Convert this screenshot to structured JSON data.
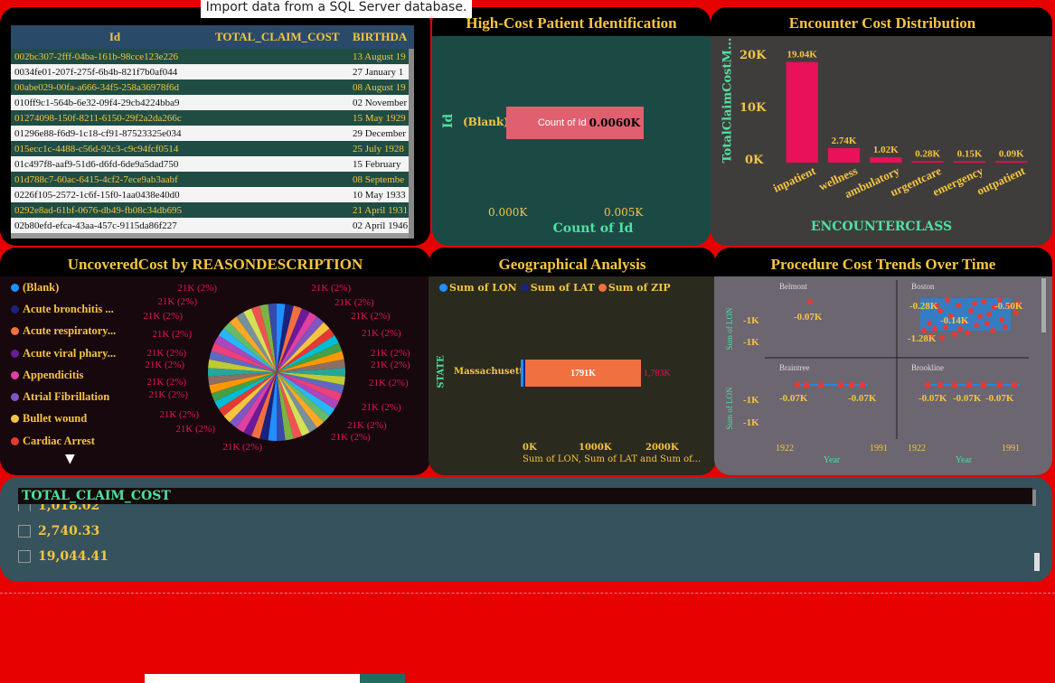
{
  "tooltip": "Import data from a SQL Server database.",
  "table": {
    "headers": [
      "Id",
      "TOTAL_CLAIM_COST",
      "BIRTHDA"
    ],
    "rows": [
      [
        "002bc307-2fff-04ba-161b-98cce123e226",
        "",
        "13 August 19"
      ],
      [
        "0034fe01-207f-275f-6b4b-821f7b0af044",
        "",
        "27 January 1"
      ],
      [
        "00abe029-00fa-a666-34f5-258a36978f6d",
        "",
        "08 August 19"
      ],
      [
        "010ff9c1-564b-6e32-09f4-29cb4224bba9",
        "",
        "02 November"
      ],
      [
        "01274098-150f-8211-6150-29f2a2da266c",
        "",
        "15 May 1929"
      ],
      [
        "01296e88-f6d9-1c18-cf91-87523325e034",
        "",
        "29 December"
      ],
      [
        "015ecc1c-4488-c56d-92c3-c9c94fcf0514",
        "",
        "25 July 1928"
      ],
      [
        "01c497f8-aaf9-51d6-d6fd-6de9a5dad750",
        "",
        "15 February"
      ],
      [
        "01d788c7-60ac-6415-4cf2-7ece9ab3aabf",
        "",
        "08 Septembe"
      ],
      [
        "0226f105-2572-1c6f-15f0-1aa0438e40d0",
        "",
        "10 May 1933"
      ],
      [
        "0292e8ad-61bf-0676-db49-fb08c34db695",
        "",
        "21 April 1931"
      ],
      [
        "02b80efd-efca-43aa-457c-9115da86f227",
        "",
        "02 April 1946"
      ]
    ]
  },
  "highcost": {
    "title": "High-Cost Patient Identification",
    "ylabel": "Id",
    "category": "(Blank)",
    "bar_label": "Count of Id",
    "value_label": "0.0060K",
    "xticks": [
      "0.000K",
      "0.005K"
    ],
    "xlabel": "Count of Id",
    "bar_color": "#e06070"
  },
  "encounter": {
    "title": "Encounter Cost Distribution",
    "ylabel": "TotalClaimCostM...",
    "xlabel": "ENCOUNTERCLASS",
    "yticks": [
      "20K",
      "10K",
      "0K"
    ],
    "bar_color": "#e8115a"
  },
  "uncovered": {
    "title": "UncoveredCost by REASONDESCRIPTION",
    "legend": [
      {
        "label": "(Blank)",
        "color": "#1e90ff"
      },
      {
        "label": "Acute bronchitis ...",
        "color": "#1a237e"
      },
      {
        "label": "Acute respiratory...",
        "color": "#f07040"
      },
      {
        "label": "Acute viral phary...",
        "color": "#6a1b9a"
      },
      {
        "label": "Appendicitis",
        "color": "#e040a0"
      },
      {
        "label": "Atrial Fibrillation",
        "color": "#7e57c2"
      },
      {
        "label": "Bullet wound",
        "color": "#f5c542"
      },
      {
        "label": "Cardiac Arrest",
        "color": "#e53935"
      }
    ],
    "slice_label": "21K (2%)",
    "expand_glyph": "▼"
  },
  "geo": {
    "title": "Geographical Analysis",
    "legend": [
      {
        "label": "Sum of LON",
        "color": "#1e90ff"
      },
      {
        "label": "Sum of LAT",
        "color": "#1a237e"
      },
      {
        "label": "Sum of ZIP",
        "color": "#f07040"
      }
    ],
    "ylabel": "STATE",
    "category": "Massachusetts",
    "bar_value": "1791K",
    "end_value": "1,783K",
    "xticks": [
      "0K",
      "1000K",
      "2000K"
    ],
    "xlabel": "Sum of LON, Sum of LAT and Sum of..."
  },
  "procedure": {
    "title": "Procedure Cost Trends Over Time",
    "cells": [
      {
        "name": "Belmont",
        "labels": [
          "-0.07K"
        ]
      },
      {
        "name": "Boston",
        "labels": [
          "-0.28K",
          "-0.50K",
          "-0.14K",
          "-1.28K"
        ]
      },
      {
        "name": "Braintree",
        "labels": [
          "-0.07K",
          "-0.07K"
        ]
      },
      {
        "name": "Brookline",
        "labels": [
          "-0.07K",
          "-0.07K",
          "-0.07K"
        ]
      }
    ],
    "yticks": [
      "-1K",
      "-1K"
    ],
    "ylabel": "Sum of LON",
    "xticks": [
      "1922",
      "1991"
    ],
    "xlabel": "Year"
  },
  "slicer": {
    "header": "TOTAL_CLAIM_COST",
    "partial": "1,018.02",
    "items": [
      "2,740.33",
      "19,044.41"
    ]
  },
  "chart_data": [
    {
      "type": "bar",
      "title": "High-Cost Patient Identification",
      "categories": [
        "(Blank)"
      ],
      "values": [
        0.006
      ],
      "xlabel": "Count of Id",
      "ylabel": "Id"
    },
    {
      "type": "bar",
      "title": "Encounter Cost Distribution",
      "categories": [
        "inpatient",
        "wellness",
        "ambulatory",
        "urgentcare",
        "emergency",
        "outpatient"
      ],
      "values": [
        19.04,
        2.74,
        1.02,
        0.28,
        0.15,
        0.09
      ],
      "value_labels": [
        "19.04K",
        "2.74K",
        "1.02K",
        "0.28K",
        "0.15K",
        "0.09K"
      ],
      "xlabel": "ENCOUNTERCLASS",
      "ylabel": "TotalClaimCostM...",
      "ylim": [
        0,
        20
      ]
    },
    {
      "type": "bar",
      "title": "Geographical Analysis",
      "categories": [
        "Massachusetts"
      ],
      "series": [
        {
          "name": "Sum of LON",
          "values": [
            -42
          ]
        },
        {
          "name": "Sum of LAT",
          "values": [
            25
          ]
        },
        {
          "name": "Sum of ZIP",
          "values": [
            1791
          ]
        }
      ],
      "xlim": [
        0,
        2000
      ]
    }
  ]
}
